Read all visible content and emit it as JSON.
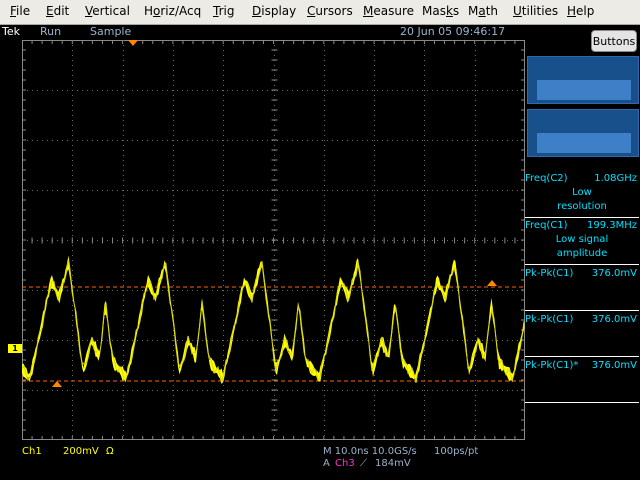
{
  "menu": [
    {
      "label": "File",
      "u": "F",
      "rest": "ile"
    },
    {
      "label": "Edit",
      "u": "E",
      "rest": "dit"
    },
    {
      "label": "Vertical",
      "u": "V",
      "rest": "ertical"
    },
    {
      "label": "Horiz/Acq",
      "u": "o",
      "pre": "H",
      "rest": "riz/Acq"
    },
    {
      "label": "Trig",
      "u": "T",
      "rest": "rig"
    },
    {
      "label": "Display",
      "u": "D",
      "rest": "isplay"
    },
    {
      "label": "Cursors",
      "u": "C",
      "rest": "ursors"
    },
    {
      "label": "Measure",
      "u": "M",
      "rest": "easure"
    },
    {
      "label": "Masks",
      "u": "k",
      "pre": "Mas",
      "rest": "s"
    },
    {
      "label": "Math",
      "u": "a",
      "pre": "M",
      "rest": "th"
    },
    {
      "label": "Utilities",
      "u": "U",
      "rest": "tilities"
    },
    {
      "label": "Help",
      "u": "H",
      "rest": "elp"
    }
  ],
  "status": {
    "brand": "Tek",
    "run_state": "Run",
    "acq_mode": "Sample",
    "datetime": "20 Jun 05 09:46:17"
  },
  "buttons_label": "Buttons",
  "measurements": {
    "m1": {
      "label": "Freq(C2)",
      "value": "1.08GHz",
      "note1": "Low",
      "note2": "resolution"
    },
    "m2": {
      "label": "Freq(C1)",
      "value": "199.3MHz",
      "note1": "Low signal",
      "note2": "amplitude"
    },
    "m3": {
      "label": "Pk-Pk(C1)",
      "value": "376.0mV"
    },
    "m4": {
      "label": "Pk-Pk(C1)",
      "value": "376.0mV"
    },
    "m5": {
      "label": "Pk-Pk(C1)*",
      "value": "376.0mV"
    }
  },
  "readout": {
    "channel": "Ch1",
    "volts_div": "200mV",
    "coupling": "Ω",
    "timebase": "M 10.0ns 10.0GS/s",
    "pts": "100ps/pt",
    "trig_prefix": "A",
    "trig_source": "Ch3",
    "trig_slope": "⟋",
    "trig_level": "184mV"
  },
  "channel_marker": "1",
  "colors": {
    "trace": "#ffff00",
    "cursor": "#ff6600",
    "grid": "#6b6b6b",
    "measurement_text": "#00e0ff"
  }
}
